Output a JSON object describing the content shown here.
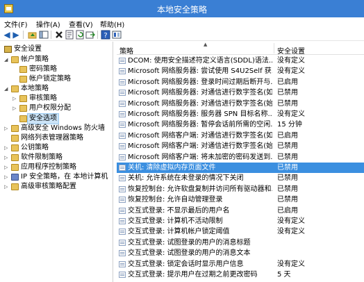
{
  "window": {
    "title": "本地安全策略"
  },
  "menu": [
    "文件(F)",
    "操作(A)",
    "查看(V)",
    "帮助(H)"
  ],
  "toolbar": {
    "buttons": [
      "back-arrow-icon",
      "forward-arrow-icon",
      "up-folder-icon",
      "show-hide-tree-icon",
      "delete-icon",
      "properties-icon",
      "refresh-icon",
      "export-list-icon",
      "help-icon",
      "view-icon"
    ]
  },
  "tree": {
    "root": "安全设置",
    "items": [
      {
        "label": "帐户策略",
        "level": 1,
        "expanded": true,
        "icon": "folder-icon"
      },
      {
        "label": "密码策略",
        "level": 2,
        "icon": "folder-icon"
      },
      {
        "label": "帐户锁定策略",
        "level": 2,
        "icon": "folder-icon"
      },
      {
        "label": "本地策略",
        "level": 1,
        "expanded": true,
        "icon": "folder-icon"
      },
      {
        "label": "审核策略",
        "level": 2,
        "collapsed": true,
        "icon": "folder-icon"
      },
      {
        "label": "用户权限分配",
        "level": 2,
        "collapsed": true,
        "icon": "folder-icon"
      },
      {
        "label": "安全选项",
        "level": 2,
        "selected": true,
        "icon": "folder-icon"
      },
      {
        "label": "高级安全 Windows 防火墙",
        "level": 1,
        "collapsed": true,
        "icon": "folder-icon"
      },
      {
        "label": "网络列表管理器策略",
        "level": 1,
        "icon": "folder-icon"
      },
      {
        "label": "公钥策略",
        "level": 1,
        "collapsed": true,
        "icon": "folder-icon"
      },
      {
        "label": "软件限制策略",
        "level": 1,
        "collapsed": true,
        "icon": "folder-icon"
      },
      {
        "label": "应用程序控制策略",
        "level": 1,
        "collapsed": true,
        "icon": "folder-icon"
      },
      {
        "label": "IP 安全策略，在 本地计算机",
        "level": 1,
        "collapsed": true,
        "icon": "shield-icon"
      },
      {
        "label": "高级审核策略配置",
        "level": 1,
        "collapsed": true,
        "icon": "folder-icon"
      }
    ]
  },
  "list": {
    "columns": {
      "policy": "策略",
      "setting": "安全设置"
    },
    "rows": [
      {
        "policy": "DCOM: 使用安全描述符定义语言(SDDL)语法...",
        "setting": "没有定义"
      },
      {
        "policy": "Microsoft 网络服务器: 尝试使用 S4U2Self 获...",
        "setting": "没有定义"
      },
      {
        "policy": "Microsoft 网络服务器: 登录时间过期后断开与...",
        "setting": "已启用"
      },
      {
        "policy": "Microsoft 网络服务器: 对通信进行数字签名(如...",
        "setting": "已禁用"
      },
      {
        "policy": "Microsoft 网络服务器: 对通信进行数字签名(始...",
        "setting": "已禁用"
      },
      {
        "policy": "Microsoft 网络服务器: 服务器 SPN 目标名称...",
        "setting": "没有定义"
      },
      {
        "policy": "Microsoft 网络服务器: 暂停会话前所需的空闲...",
        "setting": "15 分钟"
      },
      {
        "policy": "Microsoft 网络客户端: 对通信进行数字签名(如...",
        "setting": "已启用"
      },
      {
        "policy": "Microsoft 网络客户端: 对通信进行数字签名(始...",
        "setting": "已禁用"
      },
      {
        "policy": "Microsoft 网络客户端: 将未加密的密码发送到...",
        "setting": "已禁用"
      },
      {
        "policy": "关机: 清除虚拟内存页面文件",
        "setting": "已禁用",
        "selected": true
      },
      {
        "policy": "关机: 允许系统在未登录的情况下关闭",
        "setting": "已禁用"
      },
      {
        "policy": "恢复控制台: 允许软盘复制并访问所有驱动器和...",
        "setting": "已禁用"
      },
      {
        "policy": "恢复控制台: 允许自动管理登录",
        "setting": "已禁用"
      },
      {
        "policy": "交互式登录: 不显示最后的用户名",
        "setting": "已启用"
      },
      {
        "policy": "交互式登录: 计算机不活动限制",
        "setting": "没有定义"
      },
      {
        "policy": "交互式登录: 计算机帐户锁定阈值",
        "setting": "没有定义"
      },
      {
        "policy": "交互式登录: 试图登录的用户的消息标题",
        "setting": ""
      },
      {
        "policy": "交互式登录: 试图登录的用户的消息文本",
        "setting": ""
      },
      {
        "policy": "交互式登录: 锁定会话时显示用户信息",
        "setting": "没有定义"
      },
      {
        "policy": "交互式登录: 提示用户在过期之前更改密码",
        "setting": "5 天"
      }
    ]
  }
}
